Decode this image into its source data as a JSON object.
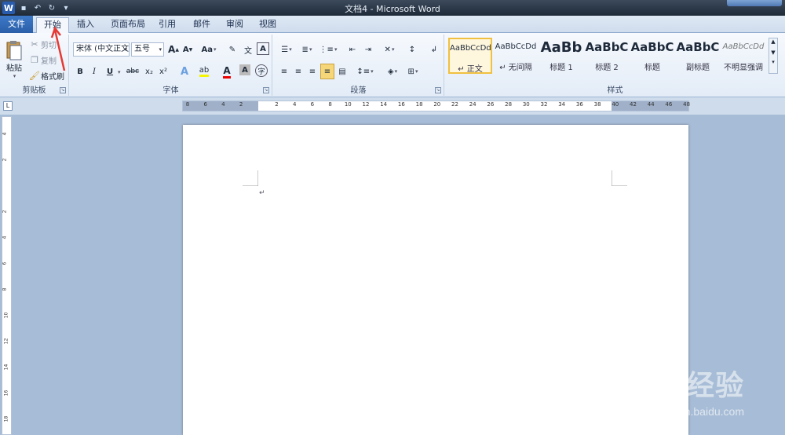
{
  "window": {
    "title": "文档4 - Microsoft Word"
  },
  "tabs": {
    "file": "文件",
    "items": [
      "开始",
      "插入",
      "页面布局",
      "引用",
      "邮件",
      "审阅",
      "视图"
    ],
    "active": "开始"
  },
  "clipboard": {
    "paste": "粘贴",
    "cut": "剪切",
    "copy": "复制",
    "format_painter": "格式刷",
    "label": "剪贴板"
  },
  "font": {
    "name": "宋体 (中文正文)",
    "size": "五号",
    "grow": "A",
    "shrink": "A",
    "case": "Aa",
    "bold": "B",
    "italic": "I",
    "underline": "U",
    "strike": "abc",
    "sub": "x₂",
    "sup": "x²",
    "label": "字体"
  },
  "paragraph": {
    "label": "段落"
  },
  "styles": {
    "label": "样式",
    "items": [
      {
        "sample": "AaBbCcDd",
        "name": "↵ 正文",
        "selected": true
      },
      {
        "sample": "AaBbCcDd",
        "name": "↵ 无间隔",
        "selected": false
      },
      {
        "sample": "AaBb",
        "name": "标题 1",
        "selected": false
      },
      {
        "sample": "AaBbC",
        "name": "标题 2",
        "selected": false
      },
      {
        "sample": "AaBbC",
        "name": "标题",
        "selected": false
      },
      {
        "sample": "AaBbC",
        "name": "副标题",
        "selected": false
      },
      {
        "sample": "AaBbCcDd",
        "name": "不明显强调",
        "selected": false
      }
    ]
  },
  "ruler": {
    "corner": "L",
    "ticks": [
      "8",
      "6",
      "4",
      "2",
      "2",
      "4",
      "6",
      "8",
      "10",
      "12",
      "14",
      "16",
      "18",
      "20",
      "22",
      "24",
      "26",
      "28",
      "30",
      "32",
      "34",
      "36",
      "38",
      "40",
      "42",
      "44",
      "46",
      "48"
    ],
    "vticks": [
      "4",
      "2",
      "2",
      "4",
      "6",
      "8",
      "10",
      "12",
      "14",
      "16",
      "18"
    ]
  },
  "document": {
    "para_mark": "↵"
  },
  "watermark": {
    "main": "Baidu经验",
    "sub": "jingyan.baidu.com"
  },
  "colors": {
    "accent": "#2b5fa8",
    "annotation": "#e53935"
  }
}
